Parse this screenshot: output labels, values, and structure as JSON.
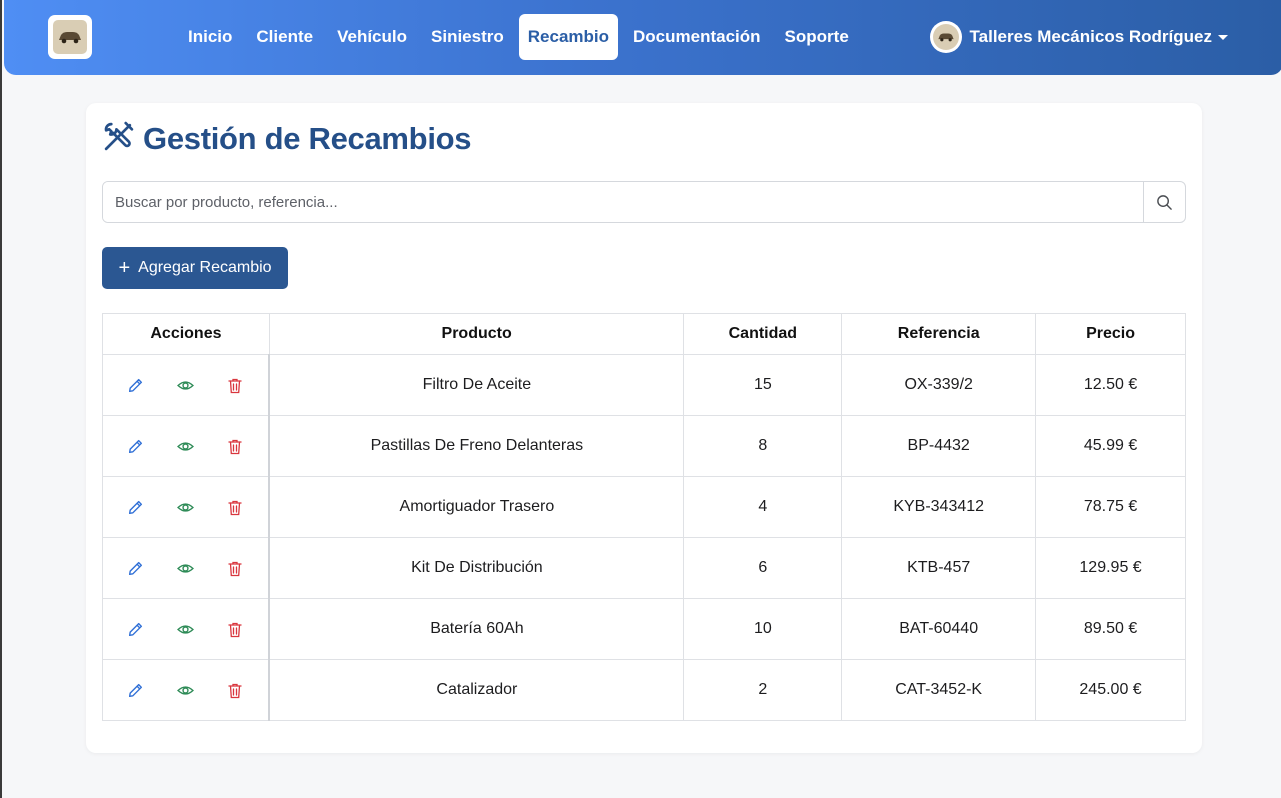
{
  "nav": {
    "items": [
      {
        "label": "Inicio",
        "active": false
      },
      {
        "label": "Cliente",
        "active": false
      },
      {
        "label": "Vehículo",
        "active": false
      },
      {
        "label": "Siniestro",
        "active": false
      },
      {
        "label": "Recambio",
        "active": true
      },
      {
        "label": "Documentación",
        "active": false
      },
      {
        "label": "Soporte",
        "active": false
      }
    ],
    "user_name": "Talleres Mecánicos Rodríguez"
  },
  "page": {
    "title": "Gestión de Recambios",
    "title_icon": "tools-icon"
  },
  "search": {
    "placeholder": "Buscar por producto, referencia...",
    "value": ""
  },
  "toolbar": {
    "add_label": "Agregar Recambio"
  },
  "table": {
    "headers": {
      "actions": "Acciones",
      "product": "Producto",
      "quantity": "Cantidad",
      "reference": "Referencia",
      "price": "Precio"
    },
    "rows": [
      {
        "product": "Filtro De Aceite",
        "quantity": "15",
        "reference": "OX-339/2",
        "price": "12.50 €"
      },
      {
        "product": "Pastillas De Freno Delanteras",
        "quantity": "8",
        "reference": "BP-4432",
        "price": "45.99 €"
      },
      {
        "product": "Amortiguador Trasero",
        "quantity": "4",
        "reference": "KYB-343412",
        "price": "78.75 €"
      },
      {
        "product": "Kit De Distribución",
        "quantity": "6",
        "reference": "KTB-457",
        "price": "129.95 €"
      },
      {
        "product": "Batería 60Ah",
        "quantity": "10",
        "reference": "BAT-60440",
        "price": "89.50 €"
      },
      {
        "product": "Catalizador",
        "quantity": "2",
        "reference": "CAT-3452-K",
        "price": "245.00 €"
      }
    ]
  },
  "colors": {
    "brand": "#2b5792",
    "nav_gradient_start": "#4f8ef4",
    "nav_gradient_end": "#2b5ea6",
    "edit": "#2f6fd6",
    "view": "#2e8b57",
    "delete": "#d9363e"
  }
}
